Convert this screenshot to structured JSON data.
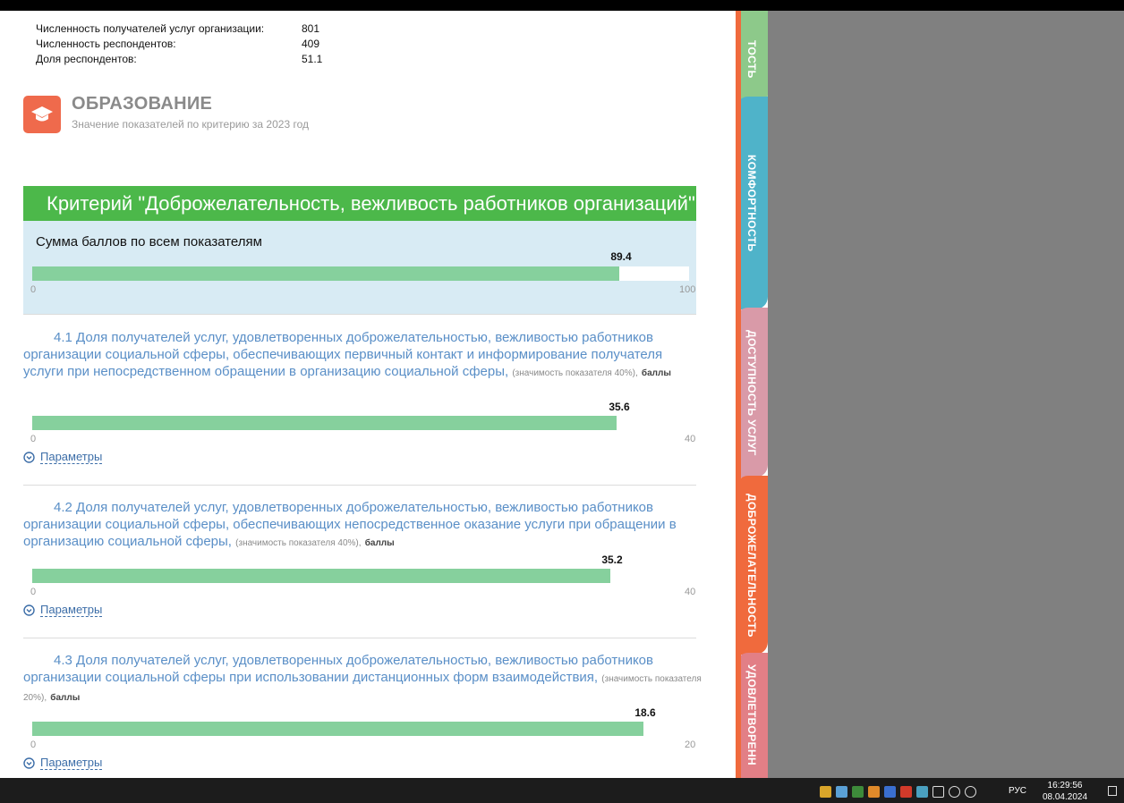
{
  "stats": [
    {
      "label": "Численность получателей услуг организации:",
      "value": "801"
    },
    {
      "label": "Численность респондентов:",
      "value": "409"
    },
    {
      "label": "Доля респондентов:",
      "value": "51.1"
    }
  ],
  "category": {
    "icon": "graduation-cap-icon",
    "title": "ОБРАЗОВАНИЕ",
    "subtitle": "Значение показателей по критерию за 2023 год"
  },
  "criterion": {
    "title": "Критерий \"Доброжелательность, вежливость работников организаций\"",
    "sum_label": "Сумма баллов по всем показателям",
    "sum_value": "89.4",
    "sum_fraction": 0.894,
    "min": "0",
    "max": "100"
  },
  "indicators": [
    {
      "text": "4.1 Доля получателей услуг, удовлетворенных доброжелательностью, вежливостью работников организации социальной сферы, обеспечивающих первичный контакт и информирование получателя услуги при непосредственном обращении в организацию социальной сферы,",
      "weight": "(значимость показателя 40%),",
      "unit": "баллы",
      "value": "35.6",
      "fraction": 0.89,
      "min": "0",
      "max": "40",
      "params_label": "Параметры"
    },
    {
      "text": "4.2 Доля получателей услуг, удовлетворенных доброжелательностью, вежливостью работников организации социальной сферы, обеспечивающих непосредственное оказание услуги при обращении в организацию социальной сферы,",
      "weight": "(значимость показателя 40%),",
      "unit": "баллы",
      "value": "35.2",
      "fraction": 0.88,
      "min": "0",
      "max": "40",
      "params_label": "Параметры"
    },
    {
      "text": "4.3 Доля получателей услуг, удовлетворенных доброжелательностью, вежливостью работников организации социальной сферы при использовании дистанционных форм взаимодействия,",
      "weight": "(значимость показателя 20%),",
      "unit": "баллы",
      "value": "18.6",
      "fraction": 0.93,
      "min": "0",
      "max": "20",
      "params_label": "Параметры"
    }
  ],
  "tabs": [
    {
      "label": "ТОСТЬ",
      "color": "#8dc98a"
    },
    {
      "label": "КОМФОРТНОСТЬ",
      "color": "#4fb3c9"
    },
    {
      "label": "ДОСТУПНОСТЬ УСЛУГ",
      "color": "#d99aa8"
    },
    {
      "label": "ДОБРОЖЕЛАТЕЛЬНОСТЬ",
      "color": "#f06a3d"
    },
    {
      "label": "УДОВЛЕТВОРЕНН",
      "color": "#e27f86"
    }
  ],
  "taskbar": {
    "language": "РУС",
    "time": "16:29:56",
    "date": "08.04.2024"
  }
}
